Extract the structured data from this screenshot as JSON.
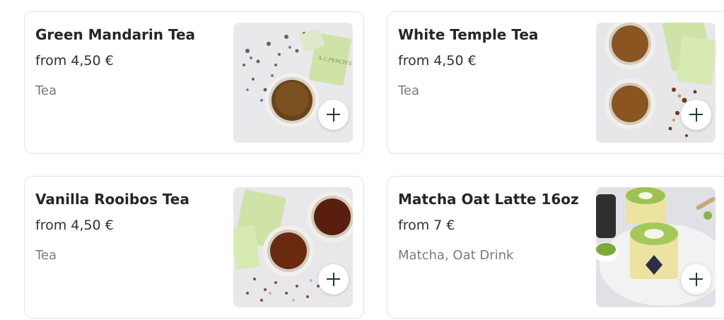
{
  "currency_icon": "euro-sign",
  "accent_color": "#1e3d33",
  "products": [
    {
      "name": "Green Mandarin Tea",
      "price": "from 4,50 €",
      "category": "Tea",
      "image": "green-tea-cup-with-sachet-photo"
    },
    {
      "name": "White Temple Tea",
      "price": "from 4,50 €",
      "category": "Tea",
      "image": "two-tea-cups-with-sachets-photo"
    },
    {
      "name": "Vanilla Rooibos Tea",
      "price": "from 4,50 €",
      "category": "Tea",
      "image": "rooibos-tea-cups-with-sachets-photo"
    },
    {
      "name": "Matcha Oat Latte 16oz",
      "price": "from 7 €",
      "category": "Matcha, Oat Drink",
      "image": "matcha-latte-cups-photo"
    }
  ]
}
